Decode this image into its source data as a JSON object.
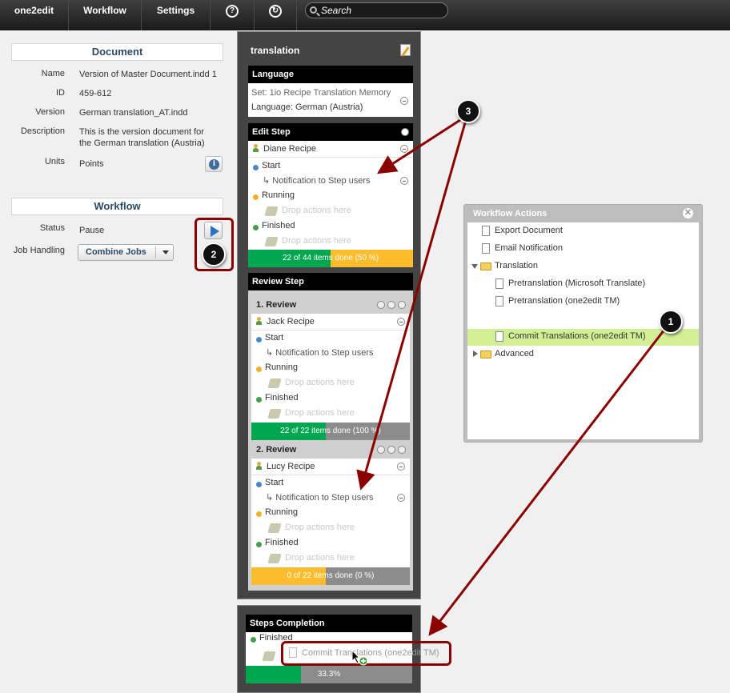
{
  "topbar": {
    "app": "one2edit",
    "workflow": "Workflow",
    "settings": "Settings",
    "help_icon": "?",
    "refresh_icon": "↻",
    "search_placeholder": "Search"
  },
  "document": {
    "header": "Document",
    "name_label": "Name",
    "name_value": "Version of Master Document.indd 1",
    "id_label": "ID",
    "id_value": "459-612",
    "version_label": "Version",
    "version_value": "German translation_AT.indd",
    "description_label": "Description",
    "description_line1": "This is the version document for",
    "description_line2": "the German translation (Austria)",
    "units_label": "Units",
    "units_value": "Points",
    "info_icon": "i"
  },
  "workflow": {
    "header": "Workflow",
    "status_label": "Status",
    "status_value": "Pause",
    "job_handling_label": "Job Handling",
    "job_handling_value": "Combine Jobs"
  },
  "translation": {
    "title": "translation",
    "language": {
      "header": "Language",
      "set_line": "Set: 1io Recipe Translation Memory",
      "language_line": "Language: German (Austria)"
    },
    "edit_step": {
      "header": "Edit Step",
      "user": "Diane Recipe",
      "start": "Start",
      "notification": "↳ Notification to Step users",
      "running": "Running",
      "drop1": "Drop actions here",
      "finished": "Finished",
      "drop2": "Drop actions here",
      "progress_label": "22 of 44 items done (50 %)",
      "progress_fraction": 0.5
    },
    "review_step": {
      "header": "Review Step",
      "review1": {
        "title": "1. Review",
        "user": "Jack Recipe",
        "start": "Start",
        "notification": "↳ Notification to Step users",
        "running": "Running",
        "drop1": "Drop actions here",
        "finished": "Finished",
        "drop2": "Drop actions here",
        "progress_label": "22 of 22 items done (100 %)",
        "progress_fraction": 0.47
      },
      "review2": {
        "title": "2. Review",
        "user": "Lucy Recipe",
        "start": "Start",
        "notification": "↳ Notification to Step users",
        "running": "Running",
        "drop1": "Drop actions here",
        "finished": "Finished",
        "drop2": "Drop actions here",
        "progress_label": "0 of 22 items done (0 %)",
        "progress_fraction": 0.47
      }
    }
  },
  "workflow_actions": {
    "title": "Workflow Actions",
    "close_icon": "✕",
    "items": {
      "export_document": "Export Document",
      "email_notification": "Email Notification",
      "translation_folder": "Translation",
      "pretranslation_ms": "Pretranslation (Microsoft Translate)",
      "pretranslation_tm": "Pretranslation (one2edit TM)",
      "commit_translations": "Commit Translations (one2edit TM)",
      "advanced_folder": "Advanced"
    }
  },
  "steps_completion": {
    "header": "Steps Completion",
    "finished": "Finished",
    "dragged_item": "Commit Translations (one2edit TM)",
    "progress_label": "33.3%",
    "progress_fraction": 0.333
  },
  "callouts": {
    "c1": "1",
    "c2": "2",
    "c3": "3"
  },
  "colors": {
    "progress_green": "#00a650",
    "progress_yellow": "#fdbc2c",
    "progress_gray": "#8c8c8c",
    "highlight": "#d3ef96",
    "annotation_red": "#8b0000"
  }
}
